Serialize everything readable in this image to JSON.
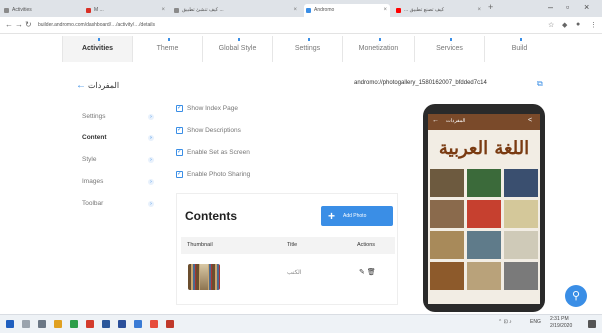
{
  "browser": {
    "tabs": [
      {
        "label": "Activities",
        "favicon_color": "#8a8a8a"
      },
      {
        "label": "M  ...",
        "favicon_color": "#d93025"
      },
      {
        "label": "كيف تنشئ تطبيق ...",
        "favicon_color": "#8a8a8a"
      },
      {
        "label": "Andromo",
        "favicon_color": "#3a8ee6"
      },
      {
        "label": "... كيف تصنع تطبيق",
        "favicon_color": "#ff0000"
      }
    ],
    "url": "builder.andromo.com/dashboard/…/activity/…/details",
    "new_tab": "+"
  },
  "app_tabs": [
    {
      "label": "Activities",
      "active": true
    },
    {
      "label": "Theme",
      "active": false
    },
    {
      "label": "Global Style",
      "active": false
    },
    {
      "label": "Settings",
      "active": false
    },
    {
      "label": "Monetization",
      "active": false
    },
    {
      "label": "Services",
      "active": false
    },
    {
      "label": "Build",
      "active": false
    }
  ],
  "page": {
    "title": "المفردات",
    "app_url": "andromo://photogallery_1580162007_bfdded7c14",
    "back_icon": "back-arrow-icon"
  },
  "sidebar": {
    "items": [
      {
        "label": "Settings",
        "active": false
      },
      {
        "label": "Content",
        "active": true
      },
      {
        "label": "Style",
        "active": false
      },
      {
        "label": "Images",
        "active": false
      },
      {
        "label": "Toolbar",
        "active": false
      }
    ]
  },
  "options": [
    {
      "label": "Show Index Page",
      "checked": true
    },
    {
      "label": "Show Descriptions",
      "checked": true
    },
    {
      "label": "Enable Set as Screen",
      "checked": true
    },
    {
      "label": "Enable Photo Sharing",
      "checked": true
    }
  ],
  "contents": {
    "title": "Contents",
    "add_button": "Add Photo",
    "columns": [
      "Thumbnail",
      "Title",
      "Actions"
    ],
    "rows": [
      {
        "title": "الكتب"
      }
    ]
  },
  "phone": {
    "header_title": "المفردات",
    "calligraphy": "اللغة العربية",
    "grid_colors": [
      "#6d5a3f",
      "#3b6a3a",
      "#3a4f6f",
      "#8a6a4c",
      "#c6402f",
      "#d4c89a",
      "#a88a5a",
      "#5f7b8a",
      "#cfcab8",
      "#8d5a2b",
      "#b9a27a",
      "#7a7a7a"
    ]
  },
  "colors": {
    "accent": "#3a8ee6",
    "phone_appbar": "#7a4a2a"
  },
  "taskbar": {
    "tray_text": "ENG",
    "time": "2:31 PM",
    "date": "2/19/2020"
  }
}
